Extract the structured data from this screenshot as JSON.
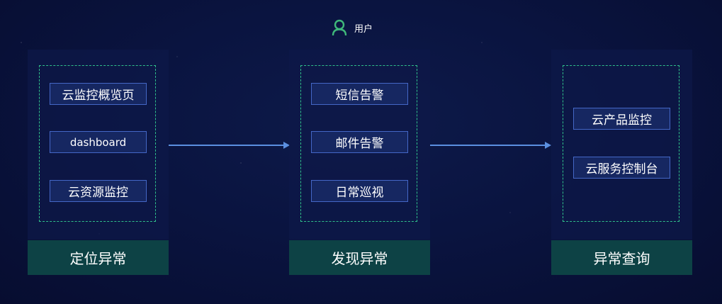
{
  "user": {
    "label": "用户",
    "icon": "user-icon",
    "icon_color": "#3fb87a"
  },
  "columns": [
    {
      "title": "定位异常",
      "items": [
        "云监控概览页",
        "dashboard",
        "云资源监控"
      ]
    },
    {
      "title": "发现异常",
      "items": [
        "短信告警",
        "邮件告警",
        "日常巡视"
      ]
    },
    {
      "title": "异常查询",
      "items": [
        "云产品监控",
        "云服务控制台"
      ]
    }
  ],
  "colors": {
    "background": "#0a1440",
    "item_border": "#4467c6",
    "item_fill": "#162761",
    "dashed_border": "#2fbf8a",
    "footer_fill": "#0d4245",
    "arrow": "#5b8fe0"
  }
}
